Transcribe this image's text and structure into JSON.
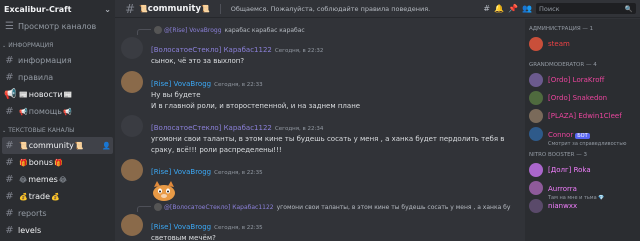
{
  "server": {
    "name": "Excalibur-Craft"
  },
  "sidebar": {
    "browse_label": "Просмотр каналов",
    "category_info": "информация",
    "info_channels": [
      {
        "name": "информация",
        "emoji": ""
      },
      {
        "name": "правила",
        "emoji": ""
      },
      {
        "name": "новости",
        "emoji": "📰"
      },
      {
        "name": "помощь",
        "emoji": "📢"
      }
    ],
    "category_text": "текстовые каналы",
    "text_channels": [
      {
        "name": "community",
        "emoji": "📜"
      },
      {
        "name": "bonus",
        "emoji": "🎁"
      },
      {
        "name": "memes",
        "emoji": "😂"
      },
      {
        "name": "trade",
        "emoji": "💰"
      },
      {
        "name": "reports",
        "emoji": ""
      },
      {
        "name": "levels",
        "emoji": ""
      }
    ]
  },
  "topbar": {
    "channel": "community",
    "topic": "Общаемся. Пожалуйста, соблюдайте правила поведения.",
    "search_placeholder": "Поиск"
  },
  "messages": [
    {
      "reply_name": "@[Rise] VovaBrogg",
      "reply_text": "карабас карабас карабас",
      "author": "[ВолосатоеСтекло] Карабас1122",
      "author_color": "#8b80d9",
      "time": "Сегодня, в 22:32",
      "lines": [
        "сынок, чё это за выхлоп?"
      ]
    },
    {
      "author": "[Rise] VovaBrogg",
      "author_color": "#3ba8f5",
      "time": "Сегодня, в 22:33",
      "lines": [
        "Ну вы будете",
        "И в главной роли, и второстепенной, и на заднем плане"
      ]
    },
    {
      "author": "[ВолосатоеСтекло] Карабас1122",
      "author_color": "#8b80d9",
      "time": "Сегодня, в 22:34",
      "lines": [
        "угомони свои таланты, в этом кине ты будешь сосать у меня , а ханка будет пердолить тебя в",
        "сраку, всё!!! роли распределены!!!"
      ]
    },
    {
      "author": "[Rise] VovaBrogg",
      "author_color": "#3ba8f5",
      "time": "Сегодня, в 22:35",
      "lines": []
    },
    {
      "reply_name": "@[ВолосатоеСтекло] Карабас1122",
      "reply_text": "угомони свои таланты, в этом кине ты будешь сосать у меня , а ханка бу",
      "author": "[Rise] VovaBrogg",
      "author_color": "#3ba8f5",
      "time": "Сегодня, в 22:35",
      "lines": [
        "световым мечём?"
      ]
    }
  ],
  "members": {
    "admin_cat": "Администрация — 1",
    "admin": [
      {
        "name": "steam",
        "color": "#ed4245"
      }
    ],
    "grandmod_cat": "GRANDMODERATOR — 4",
    "grandmods": [
      {
        "name": "[Ordo] LoraKroff",
        "color": "#eb459e",
        "sub": ""
      },
      {
        "name": "[Ordo] Snakedon",
        "color": "#eb459e",
        "sub": ""
      },
      {
        "name": "[PLAZA] Edwin1Cleef",
        "color": "#eb459e",
        "sub": ""
      },
      {
        "name": "Connor",
        "color": "#eb459e",
        "badge": "БОТ",
        "sub": "Смотрит за справедливостью"
      }
    ],
    "booster_cat": "NITRO BOOSTER — 3",
    "boosters": [
      {
        "name": "[Долг] Roka",
        "color": "#f47fff",
        "sub": ""
      },
      {
        "name": "Aurrorra",
        "color": "#f47fff",
        "sub": "Там на мне и тьма 💎"
      },
      {
        "name": "nianwxx",
        "color": "#f47fff",
        "sub": ""
      }
    ]
  }
}
